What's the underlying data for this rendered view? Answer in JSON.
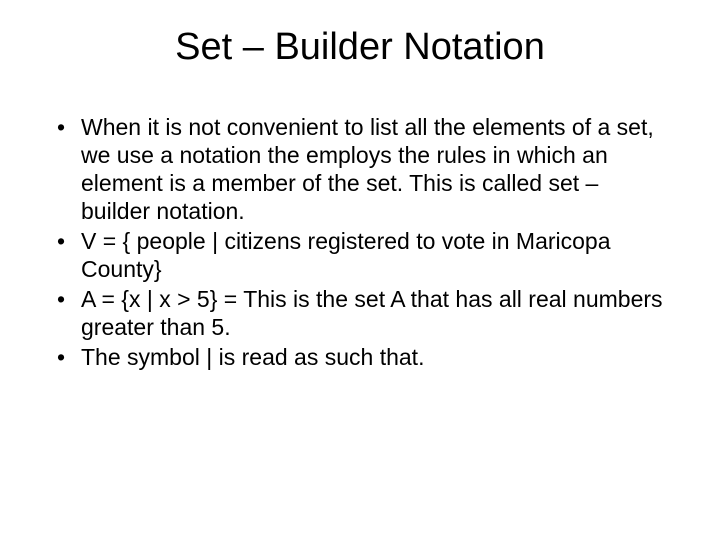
{
  "slide": {
    "title": "Set – Builder Notation",
    "bullets": [
      "When it is not convenient to list all the elements of a set, we use a notation the employs the rules in which an element is a member of the set. This is called set – builder notation.",
      "V = { people | citizens registered to vote in Maricopa County}",
      "A = {x | x > 5} = This is the set A that has all real numbers greater than 5.",
      "The symbol | is read as such that."
    ]
  }
}
